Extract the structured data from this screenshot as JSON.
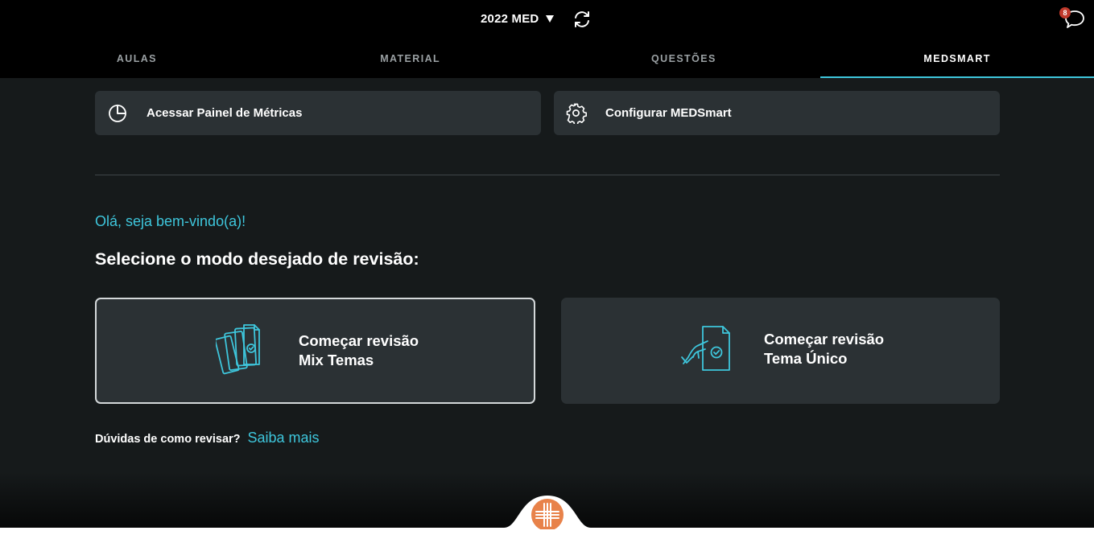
{
  "header": {
    "year_select": "2022 MED",
    "notification_count": "8"
  },
  "tabs": [
    {
      "label": "AULAS",
      "active": false
    },
    {
      "label": "MATERIAL",
      "active": false
    },
    {
      "label": "QUESTÕES",
      "active": false
    },
    {
      "label": "MEDSMART",
      "active": true
    }
  ],
  "actions": {
    "metrics_label": "Acessar Painel de Métricas",
    "config_label": "Configurar MEDSmart"
  },
  "welcome": "Olá, seja bem-vindo(a)!",
  "select_heading": "Selecione o modo desejado de revisão:",
  "modes": {
    "mix": {
      "line1": "Começar revisão",
      "line2": "Mix Temas"
    },
    "single": {
      "line1": "Começar revisão",
      "line2": "Tema Único"
    }
  },
  "help": {
    "question": "Dúvidas de como revisar?",
    "link": "Saiba mais"
  },
  "icons": {
    "metrics": "pie-chart-icon",
    "config": "gear-icon",
    "refresh": "refresh-icon",
    "chat": "chat-icon",
    "mix": "stacked-cards-icon",
    "single": "hand-document-icon",
    "logo": "medical-cross-logo"
  },
  "colors": {
    "accent": "#3ec6dc",
    "background": "#161a1b",
    "card": "#2b3134",
    "logo": "#e8824a",
    "badge": "#c0392b"
  }
}
